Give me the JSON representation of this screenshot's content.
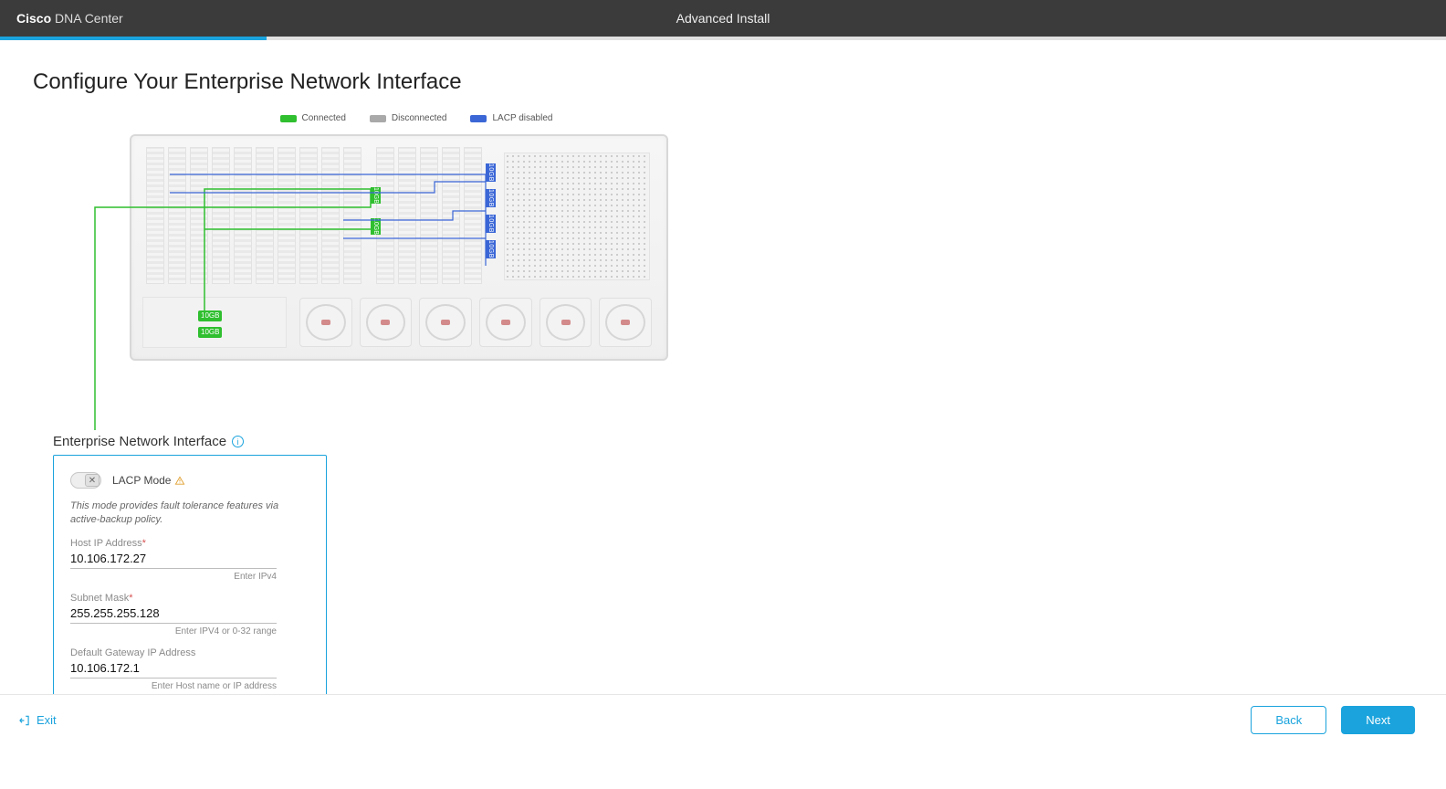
{
  "header": {
    "brand_bold": "Cisco",
    "brand_light": " DNA Center",
    "center_title": "Advanced Install"
  },
  "progress": {
    "percent": 18
  },
  "page": {
    "title": "Configure Your Enterprise Network Interface"
  },
  "legend": {
    "connected": "Connected",
    "disconnected": "Disconnected",
    "lacp_disabled": "LACP disabled"
  },
  "diagram": {
    "port_labels": {
      "blue_10gb": "10GB",
      "green_10gb": "10GB",
      "nic_10gb_top": "10GB",
      "nic_10gb_bottom": "10GB"
    }
  },
  "panel": {
    "title": "Enterprise Network Interface",
    "toggle": {
      "label": "LACP Mode",
      "state": "off",
      "knob_glyph": "✕"
    },
    "mode_desc": "This mode provides fault tolerance features via active-backup policy.",
    "fields": {
      "host_ip": {
        "label": "Host IP Address",
        "required": true,
        "value": "10.106.172.27",
        "help": "Enter IPv4"
      },
      "subnet": {
        "label": "Subnet Mask",
        "required": true,
        "value": "255.255.255.128",
        "help": "Enter IPV4 or 0-32 range"
      },
      "gateway": {
        "label": "Default Gateway IP Address",
        "required": false,
        "value": "10.106.172.1",
        "help": "Enter Host name or IP address"
      }
    }
  },
  "footer": {
    "exit": "Exit",
    "back": "Back",
    "next": "Next"
  }
}
